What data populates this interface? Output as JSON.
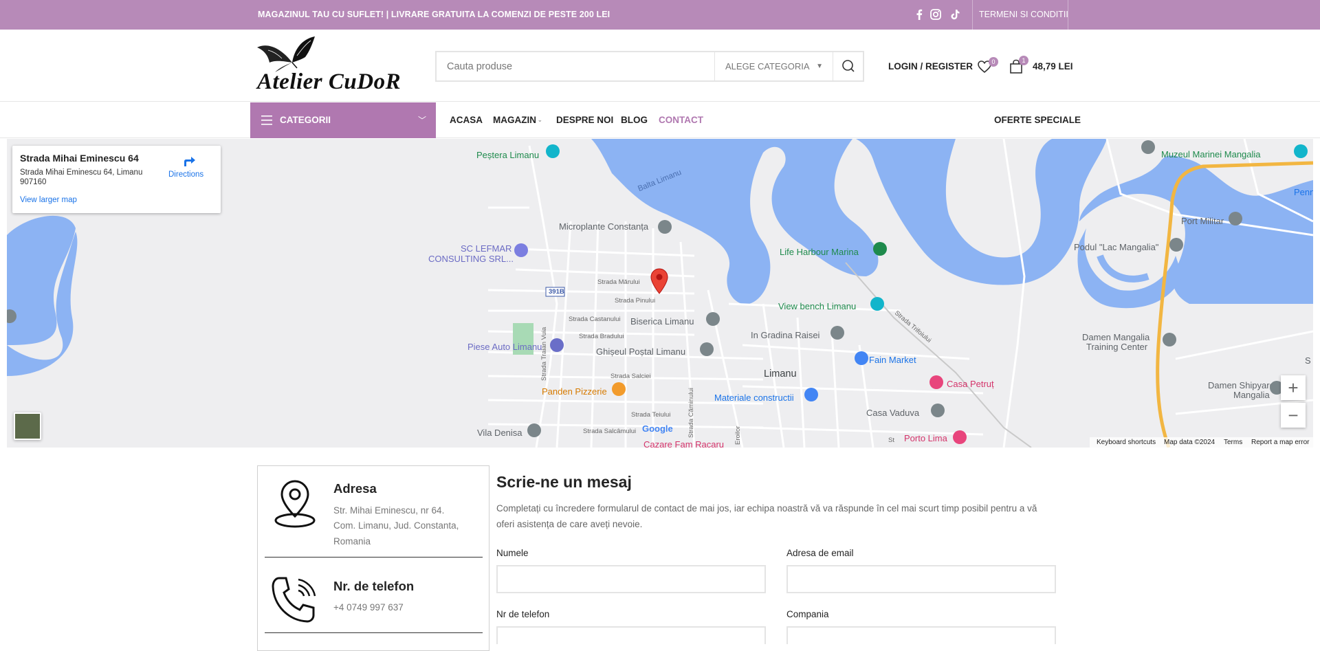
{
  "topbar": {
    "promo": "MAGAZINUL TAU CU SUFLET! | LIVRARE GRATUITA LA COMENZI DE PESTE 200 LEI",
    "social": [
      "facebook-icon",
      "instagram-icon",
      "tiktok-icon"
    ],
    "terms": "TERMENI SI CONDITII",
    "color": "#b78ab8"
  },
  "header": {
    "logo_text": "Atelier CuDoR",
    "search_placeholder": "Cauta produse",
    "category_label": "ALEGE CATEGORIA",
    "login": "LOGIN / REGISTER",
    "wishlist_count": "0",
    "cart_count": "1",
    "cart_total": "48,79 LEI"
  },
  "nav": {
    "categories": "CATEGORII",
    "links": [
      "ACASA",
      "MAGAZIN",
      "DESPRE NOI",
      "BLOG",
      "CONTACT"
    ],
    "active": "CONTACT",
    "special": "OFERTE SPECIALE",
    "accent": "#b078b0"
  },
  "map": {
    "info_title": "Strada Mihai Eminescu 64",
    "info_address": "Strada Mihai Eminescu 64, Limanu 907160",
    "directions": "Directions",
    "view_larger": "View larger map",
    "labels": {
      "pestera": "Peștera Limanu",
      "balta": "Balta Limanu",
      "microplante": "Microplante Constanța",
      "lefmar1": "SC LEFMAR",
      "lefmar2": "CONSULTING SRL...",
      "road391b": "391B",
      "s_marului": "Strada Mărului",
      "s_pinului": "Strada Pinului",
      "s_castanului": "Strada Castanului",
      "s_bradului": "Strada Bradului",
      "biserica": "Biserica Limanu",
      "piese": "Piese Auto Limanu",
      "ghiseul": "Ghișeul Poștal Limanu",
      "s_traian": "Strada Traian Vuia",
      "s_salciei": "Strada Salciei",
      "panden": "Panden Pizzerie",
      "s_teiului": "Strada Teiului",
      "s_caminului": "Strada Căminului",
      "vila": "Vila Denisa",
      "s_salcamului": "Strada Salcâmului",
      "cazare": "Cazare Fam Racaru",
      "eroilor": "Eroilor",
      "life_harbour": "Life Harbour Marina",
      "view_bench": "View bench Limanu",
      "s_trifoiului": "Strada Trifoiului",
      "gradina": "In Gradina Raisei",
      "fain": "Fain Market",
      "limanu": "Limanu",
      "materiale": "Materiale constructii",
      "casa_petrut": "Casa Petruț",
      "casa_vaduva": "Casa Vaduva",
      "porto": "Porto Lima",
      "muzeul": "Muzeul Marinei Mangalia",
      "penn": "Penn",
      "port_militar": "Port Militar",
      "podul": "Podul \"Lac Mangalia\"",
      "damen_tc1": "Damen Mangalia",
      "damen_tc2": "Training Center",
      "damen_sy1": "Damen Shipyards",
      "damen_sy2": "Mangalia",
      "s_edge": "S",
      "st": "St"
    },
    "attribution": {
      "google": "Google",
      "shortcuts": "Keyboard shortcuts",
      "mapdata": "Map data ©2024",
      "terms": "Terms",
      "report": "Report a map error"
    },
    "zoom_in": "+",
    "zoom_out": "−"
  },
  "contact": {
    "address_title": "Adresa",
    "address_lines": [
      "Str. Mihai Eminescu, nr 64.",
      "Com. Limanu, Jud. Constanta,",
      "Romania"
    ],
    "phone_title": "Nr. de telefon",
    "phone": "+4 0749 997 637"
  },
  "form": {
    "title": "Scrie-ne un mesaj",
    "description": "Completați cu încredere formularul de contact de mai jos, iar echipa noastră vă va răspunde în cel mai scurt timp posibil pentru a vă oferi asistența de care aveți nevoie.",
    "fields": [
      "Numele",
      "Adresa de email",
      "Nr de telefon",
      "Compania"
    ]
  }
}
